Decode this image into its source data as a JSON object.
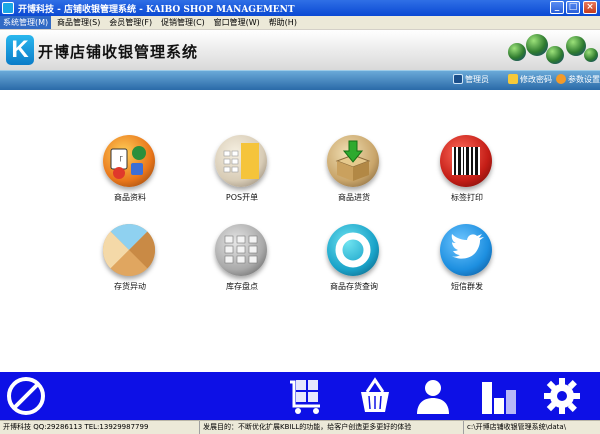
{
  "window": {
    "title": "开博科技 - 店铺收银管理系统 - KAIBO SHOP MANAGEMENT",
    "buttons": {
      "minimize": "_",
      "maximize": "□",
      "close": "×"
    }
  },
  "menu": [
    {
      "label": "系统管理(M)",
      "active": true
    },
    {
      "label": "商品管理(S)"
    },
    {
      "label": "会员管理(F)"
    },
    {
      "label": "促销管理(C)"
    },
    {
      "label": "窗口管理(W)"
    },
    {
      "label": "帮助(H)"
    }
  ],
  "banner": {
    "logo_letter": "K",
    "app_name": "开博店铺收银管理系统"
  },
  "toolbar": {
    "user": "管理员",
    "change_password": "修改密码",
    "settings": "参数设置"
  },
  "tiles": [
    {
      "label": "商品资料",
      "icon": "product-info-icon"
    },
    {
      "label": "POS开单",
      "icon": "calculator-icon"
    },
    {
      "label": "商品进货",
      "icon": "stock-in-icon"
    },
    {
      "label": "标签打印",
      "icon": "barcode-icon"
    },
    {
      "label": "存货异动",
      "icon": "inventory-change-icon"
    },
    {
      "label": "库存盘点",
      "icon": "keypad-icon"
    },
    {
      "label": "商品存货查询",
      "icon": "stock-query-icon"
    },
    {
      "label": "短信群发",
      "icon": "bird-sms-icon"
    }
  ],
  "bottom_icons": [
    "stop-icon",
    "cart-icon",
    "basket-icon",
    "user-icon",
    "chart-icon",
    "gear-icon"
  ],
  "status": {
    "company": "开博科技 QQ:29286113 TEL:13929987799",
    "message": "发展目的：不断优化扩展KBILL的功能，给客户创造更多更好的体验",
    "path": "c:\\开博店铺收银管理系统\\data\\"
  },
  "colors": {
    "titlebar": "#0a49d3",
    "bottombar": "#0d10e6",
    "accent": "#316ac5"
  }
}
